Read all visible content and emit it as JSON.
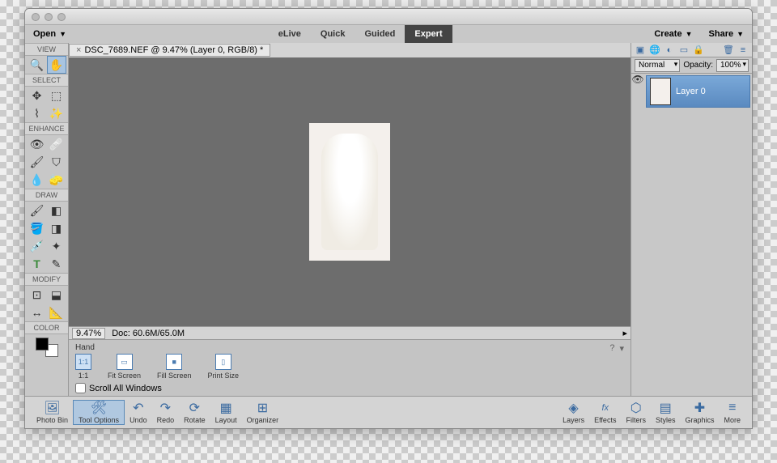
{
  "menu": {
    "open": "Open",
    "create": "Create",
    "share": "Share"
  },
  "modes": {
    "elive": "eLive",
    "quick": "Quick",
    "guided": "Guided",
    "expert": "Expert"
  },
  "toolHeaders": {
    "view": "VIEW",
    "select": "SELECT",
    "enhance": "ENHANCE",
    "draw": "DRAW",
    "modify": "MODIFY",
    "color": "COLOR"
  },
  "docTab": {
    "name": "DSC_7689.NEF @ 9.47% (Layer 0, RGB/8) *"
  },
  "status": {
    "zoom": "9.47%",
    "doc": "Doc: 60.6M/65.0M"
  },
  "options": {
    "tool": "Hand",
    "oneToOne": "1:1",
    "fitScreen": "Fit Screen",
    "fillScreen": "Fill Screen",
    "printSize": "Print Size",
    "scrollAll": "Scroll All Windows"
  },
  "layers": {
    "blendMode": "Normal",
    "opacityLabel": "Opacity:",
    "opacityValue": "100%",
    "layer0": "Layer 0"
  },
  "bottombar": {
    "photoBin": "Photo Bin",
    "toolOptions": "Tool Options",
    "undo": "Undo",
    "redo": "Redo",
    "rotate": "Rotate",
    "layout": "Layout",
    "organizer": "Organizer",
    "layers": "Layers",
    "effects": "Effects",
    "filters": "Filters",
    "styles": "Styles",
    "graphics": "Graphics",
    "more": "More"
  }
}
